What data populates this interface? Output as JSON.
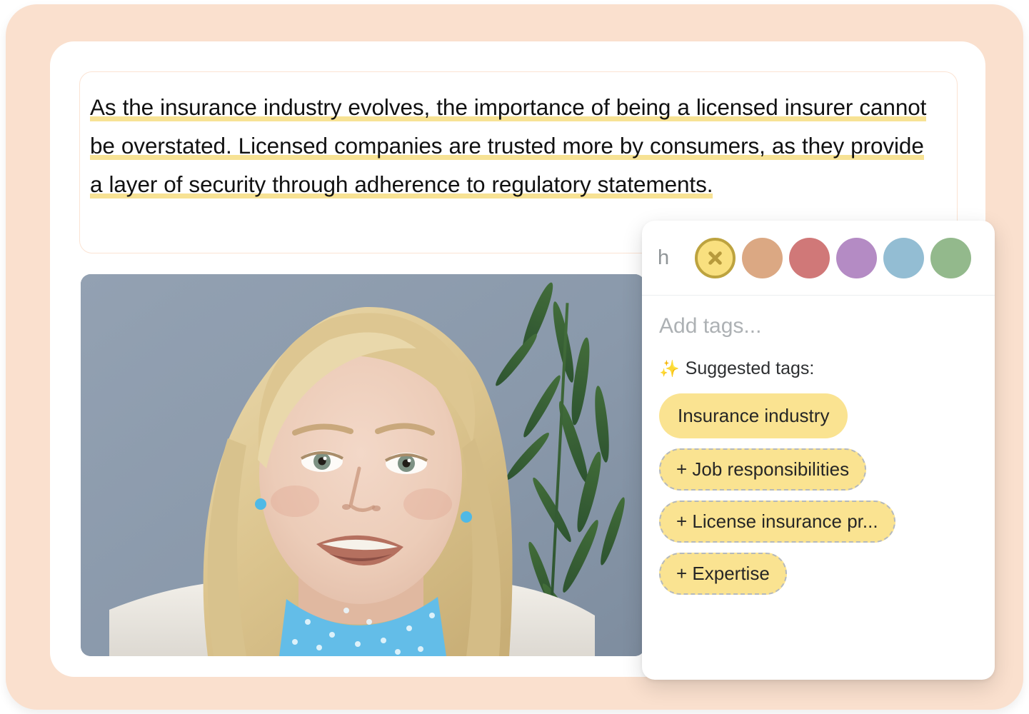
{
  "transcript": {
    "text": "As the insurance industry evolves, the importance of being a licensed insurer cannot be overstated. Licensed companies are trusted more by consumers, as they provide a layer of security through adherence to regulatory statements.",
    "highlight_color": "#f7e294"
  },
  "media": {
    "alt": "Blonde woman in white coat with blue polka dot scarf speaking, grey wall and green plant behind her"
  },
  "tag_popup": {
    "highlight_letter": "h",
    "colors": [
      {
        "name": "yellow",
        "hex": "#f9e07f",
        "selected": true,
        "ring": "#bda33f"
      },
      {
        "name": "orange",
        "hex": "#dba883",
        "selected": false
      },
      {
        "name": "red",
        "hex": "#d07878",
        "selected": false
      },
      {
        "name": "purple",
        "hex": "#b48bc4",
        "selected": false
      },
      {
        "name": "blue",
        "hex": "#93bdd3",
        "selected": false
      },
      {
        "name": "green",
        "hex": "#93b98c",
        "selected": false
      }
    ],
    "add_tags_placeholder": "Add tags...",
    "add_tags_value": "",
    "suggested_label": "Suggested tags:",
    "sparkle_icon": "✨",
    "suggested_tags": [
      {
        "label": "Insurance industry",
        "dashed": false
      },
      {
        "label": "+ Job responsibilities",
        "dashed": true
      },
      {
        "label": "+ License insurance pr...",
        "dashed": true
      },
      {
        "label": "+ Expertise",
        "dashed": true
      }
    ]
  },
  "theme": {
    "frame_bg": "#fae0ce",
    "card_bg": "#ffffff",
    "tag_bg": "#fae391",
    "divider": "#eceef0"
  }
}
